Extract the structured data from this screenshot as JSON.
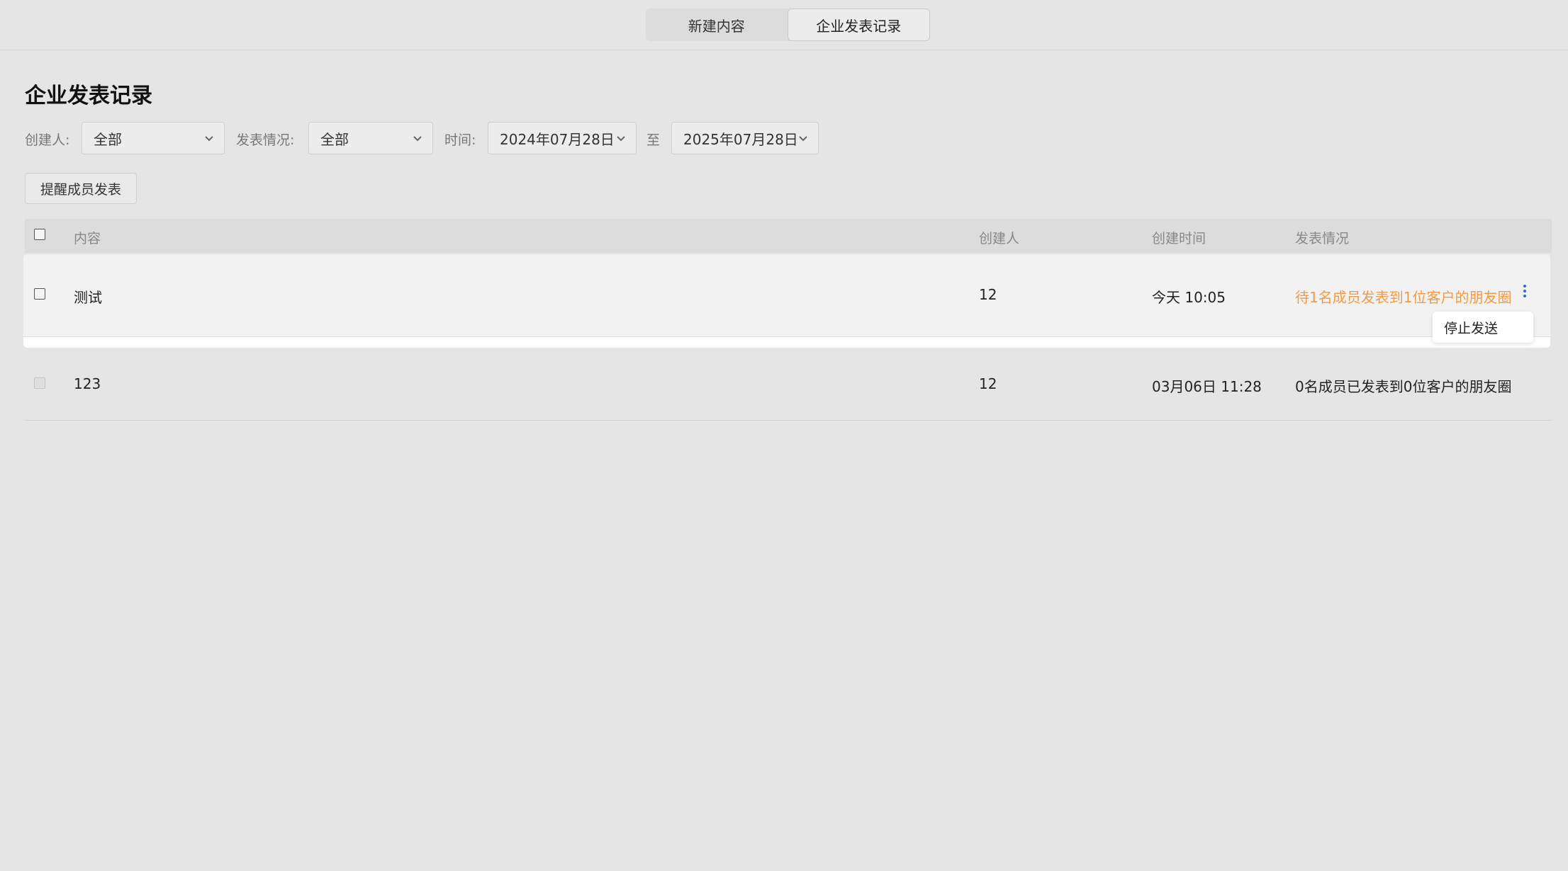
{
  "tabs": [
    {
      "label": "新建内容",
      "active": false
    },
    {
      "label": "企业发表记录",
      "active": true
    }
  ],
  "page_title": "企业发表记录",
  "filters": {
    "creator_label": "创建人:",
    "creator_value": "全部",
    "status_label": "发表情况:",
    "status_value": "全部",
    "time_label": "时间:",
    "date_from": "2024年07月28日",
    "date_sep": "至",
    "date_to": "2025年07月28日"
  },
  "remind_button": "提醒成员发表",
  "table": {
    "headers": [
      "内容",
      "创建人",
      "创建时间",
      "发表情况"
    ],
    "rows": [
      {
        "content": "测试",
        "creator": "12",
        "created_at": "今天 10:05",
        "status": "待1名成员发表到1位客户的朋友圈",
        "status_color": "#f29a45"
      },
      {
        "content": "123",
        "creator": "12",
        "created_at": "03月06日 11:28",
        "status": "0名成员已发表到0位客户的朋友圈",
        "status_color": "#222222"
      }
    ]
  },
  "popover": {
    "stop_label": "停止发送"
  },
  "colors": {
    "accent_orange": "#f29a45",
    "more_icon_blue": "#2f6bd8",
    "background": "#e5e5e5"
  }
}
